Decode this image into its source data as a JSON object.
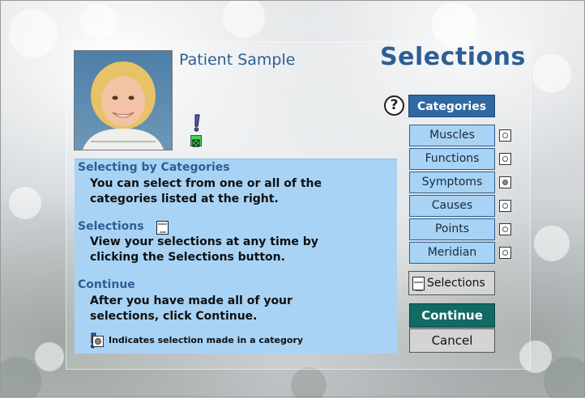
{
  "patient": {
    "name": "Patient Sample"
  },
  "page": {
    "title": "Selections"
  },
  "info": {
    "section1_heading": "Selecting by Categories",
    "section1_body": "You can select from one or all of the\ncategories listed at the right.",
    "section2_heading": "Selections",
    "section2_body": "View your selections at any time by\nclicking the Selections button.",
    "section3_heading": "Continue",
    "section3_body": "After you have made all of your\nselections, click Continue.",
    "legend": "Indicates selection made in a category"
  },
  "categories": {
    "header": "Categories",
    "help_glyph": "?",
    "items": [
      {
        "label": "Muscles",
        "selected": false
      },
      {
        "label": "Functions",
        "selected": false
      },
      {
        "label": "Symptoms",
        "selected": true
      },
      {
        "label": "Causes",
        "selected": false
      },
      {
        "label": "Points",
        "selected": false
      },
      {
        "label": "Meridian",
        "selected": false
      }
    ]
  },
  "buttons": {
    "selections": "Selections",
    "continue": "Continue",
    "cancel": "Cancel"
  },
  "colors": {
    "title_blue": "#2d5f93",
    "info_bg": "#a8d3f5",
    "header_bg": "#2f68a3",
    "continue_bg": "#116a64"
  },
  "icons": {
    "exclamation": "exclamation-icon",
    "checkbox": "checkbox-icon",
    "notepad": "notepad-icon",
    "help": "help-icon"
  }
}
